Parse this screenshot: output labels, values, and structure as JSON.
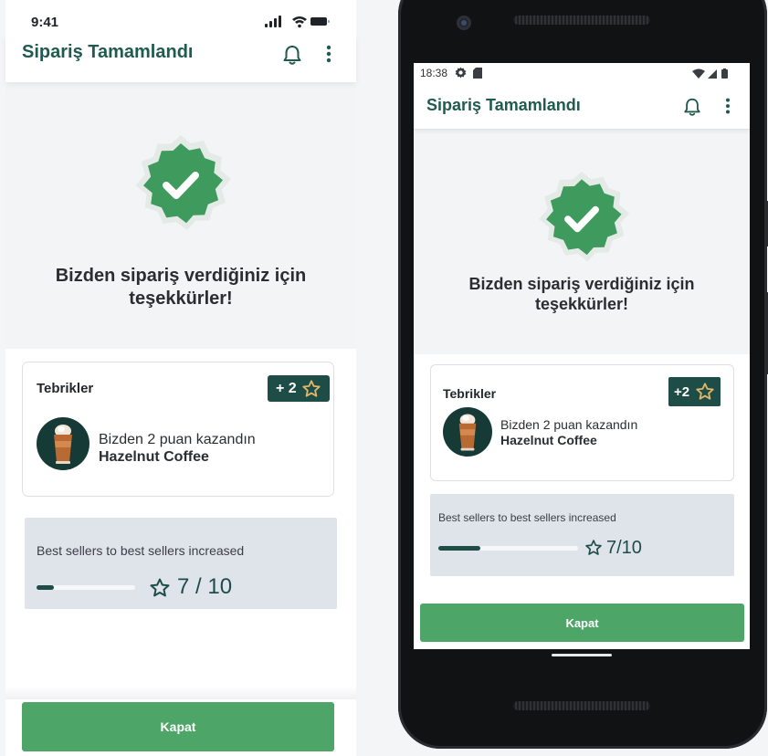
{
  "left": {
    "status": {
      "time": "9:41"
    },
    "app_bar": {
      "title": "Sipariş Tamamlandı"
    },
    "hero": {
      "thanks": "Bizden sipariş verdiğiniz için teşekkürler!"
    },
    "reward": {
      "title": "Tebrikler",
      "points": "+ 2",
      "message": "Bizden 2 puan kazandın",
      "product": "Hazelnut Coffee"
    },
    "progress": {
      "label": "Best sellers to best sellers increased",
      "count": "7 / 10",
      "fraction": 0.18
    },
    "close_label": "Kapat"
  },
  "right": {
    "status": {
      "time": "18:38"
    },
    "app_bar": {
      "title": "Sipariş Tamamlandı"
    },
    "hero": {
      "thanks": "Bizden sipariş verdiğiniz için teşekkürler!"
    },
    "reward": {
      "title": "Tebrikler",
      "points": "+2",
      "message": "Bizden 2 puan kazandın",
      "product": "Hazelnut Coffee"
    },
    "progress": {
      "label": "Best sellers to best sellers increased",
      "count": "7/10",
      "fraction": 0.3
    },
    "close_label": "Kapat"
  },
  "icons": {
    "badge": "verified-check-icon",
    "bell": "bell-icon",
    "menu": "more-vertical-icon",
    "star": "star-icon",
    "product_image": "iced-coffee-icon",
    "signal": "signal-icon",
    "wifi": "wifi-icon",
    "battery": "battery-icon",
    "settings": "gear-icon",
    "sd_card": "sd-card-icon"
  },
  "colors": {
    "brand_dark": "#1e4d47",
    "title_green": "#1f5b4e",
    "action_green": "#4ea568",
    "badge_green": "#3f9a5e",
    "progress_bg": "#dfe3ea",
    "chip_star": "#e0b66a"
  }
}
